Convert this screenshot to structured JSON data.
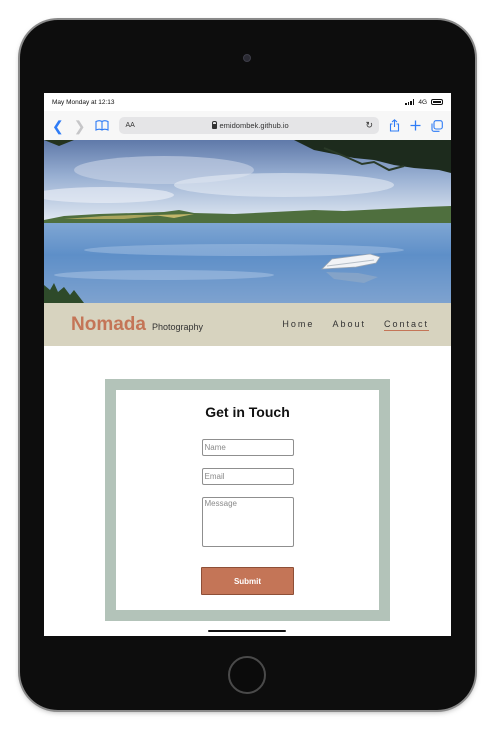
{
  "status_bar": {
    "time": "May Monday at 12:13",
    "network": "4G"
  },
  "browser": {
    "text_size_label": "AA",
    "url": "emidombek.github.io",
    "icons": [
      "back-icon",
      "forward-icon",
      "bookmarks-icon",
      "lock-icon",
      "reload-icon",
      "share-icon",
      "new-tab-icon",
      "tabs-icon"
    ]
  },
  "hero": {
    "image_subject": "lake-with-rowboat-photo"
  },
  "site": {
    "brand": "Nomada",
    "brand_sub": "Photography",
    "nav": [
      {
        "label": "Home",
        "active": false
      },
      {
        "label": "About",
        "active": false
      },
      {
        "label": "Contact",
        "active": true
      }
    ]
  },
  "contact_form": {
    "title": "Get in Touch",
    "name_placeholder": "Name",
    "email_placeholder": "Email",
    "message_placeholder": "Message",
    "submit_label": "Submit"
  },
  "colors": {
    "accent": "#c47557",
    "header_bg": "#d7d3bf",
    "form_border": "#b3c3b9",
    "browser_blue": "#2f7cf6"
  }
}
